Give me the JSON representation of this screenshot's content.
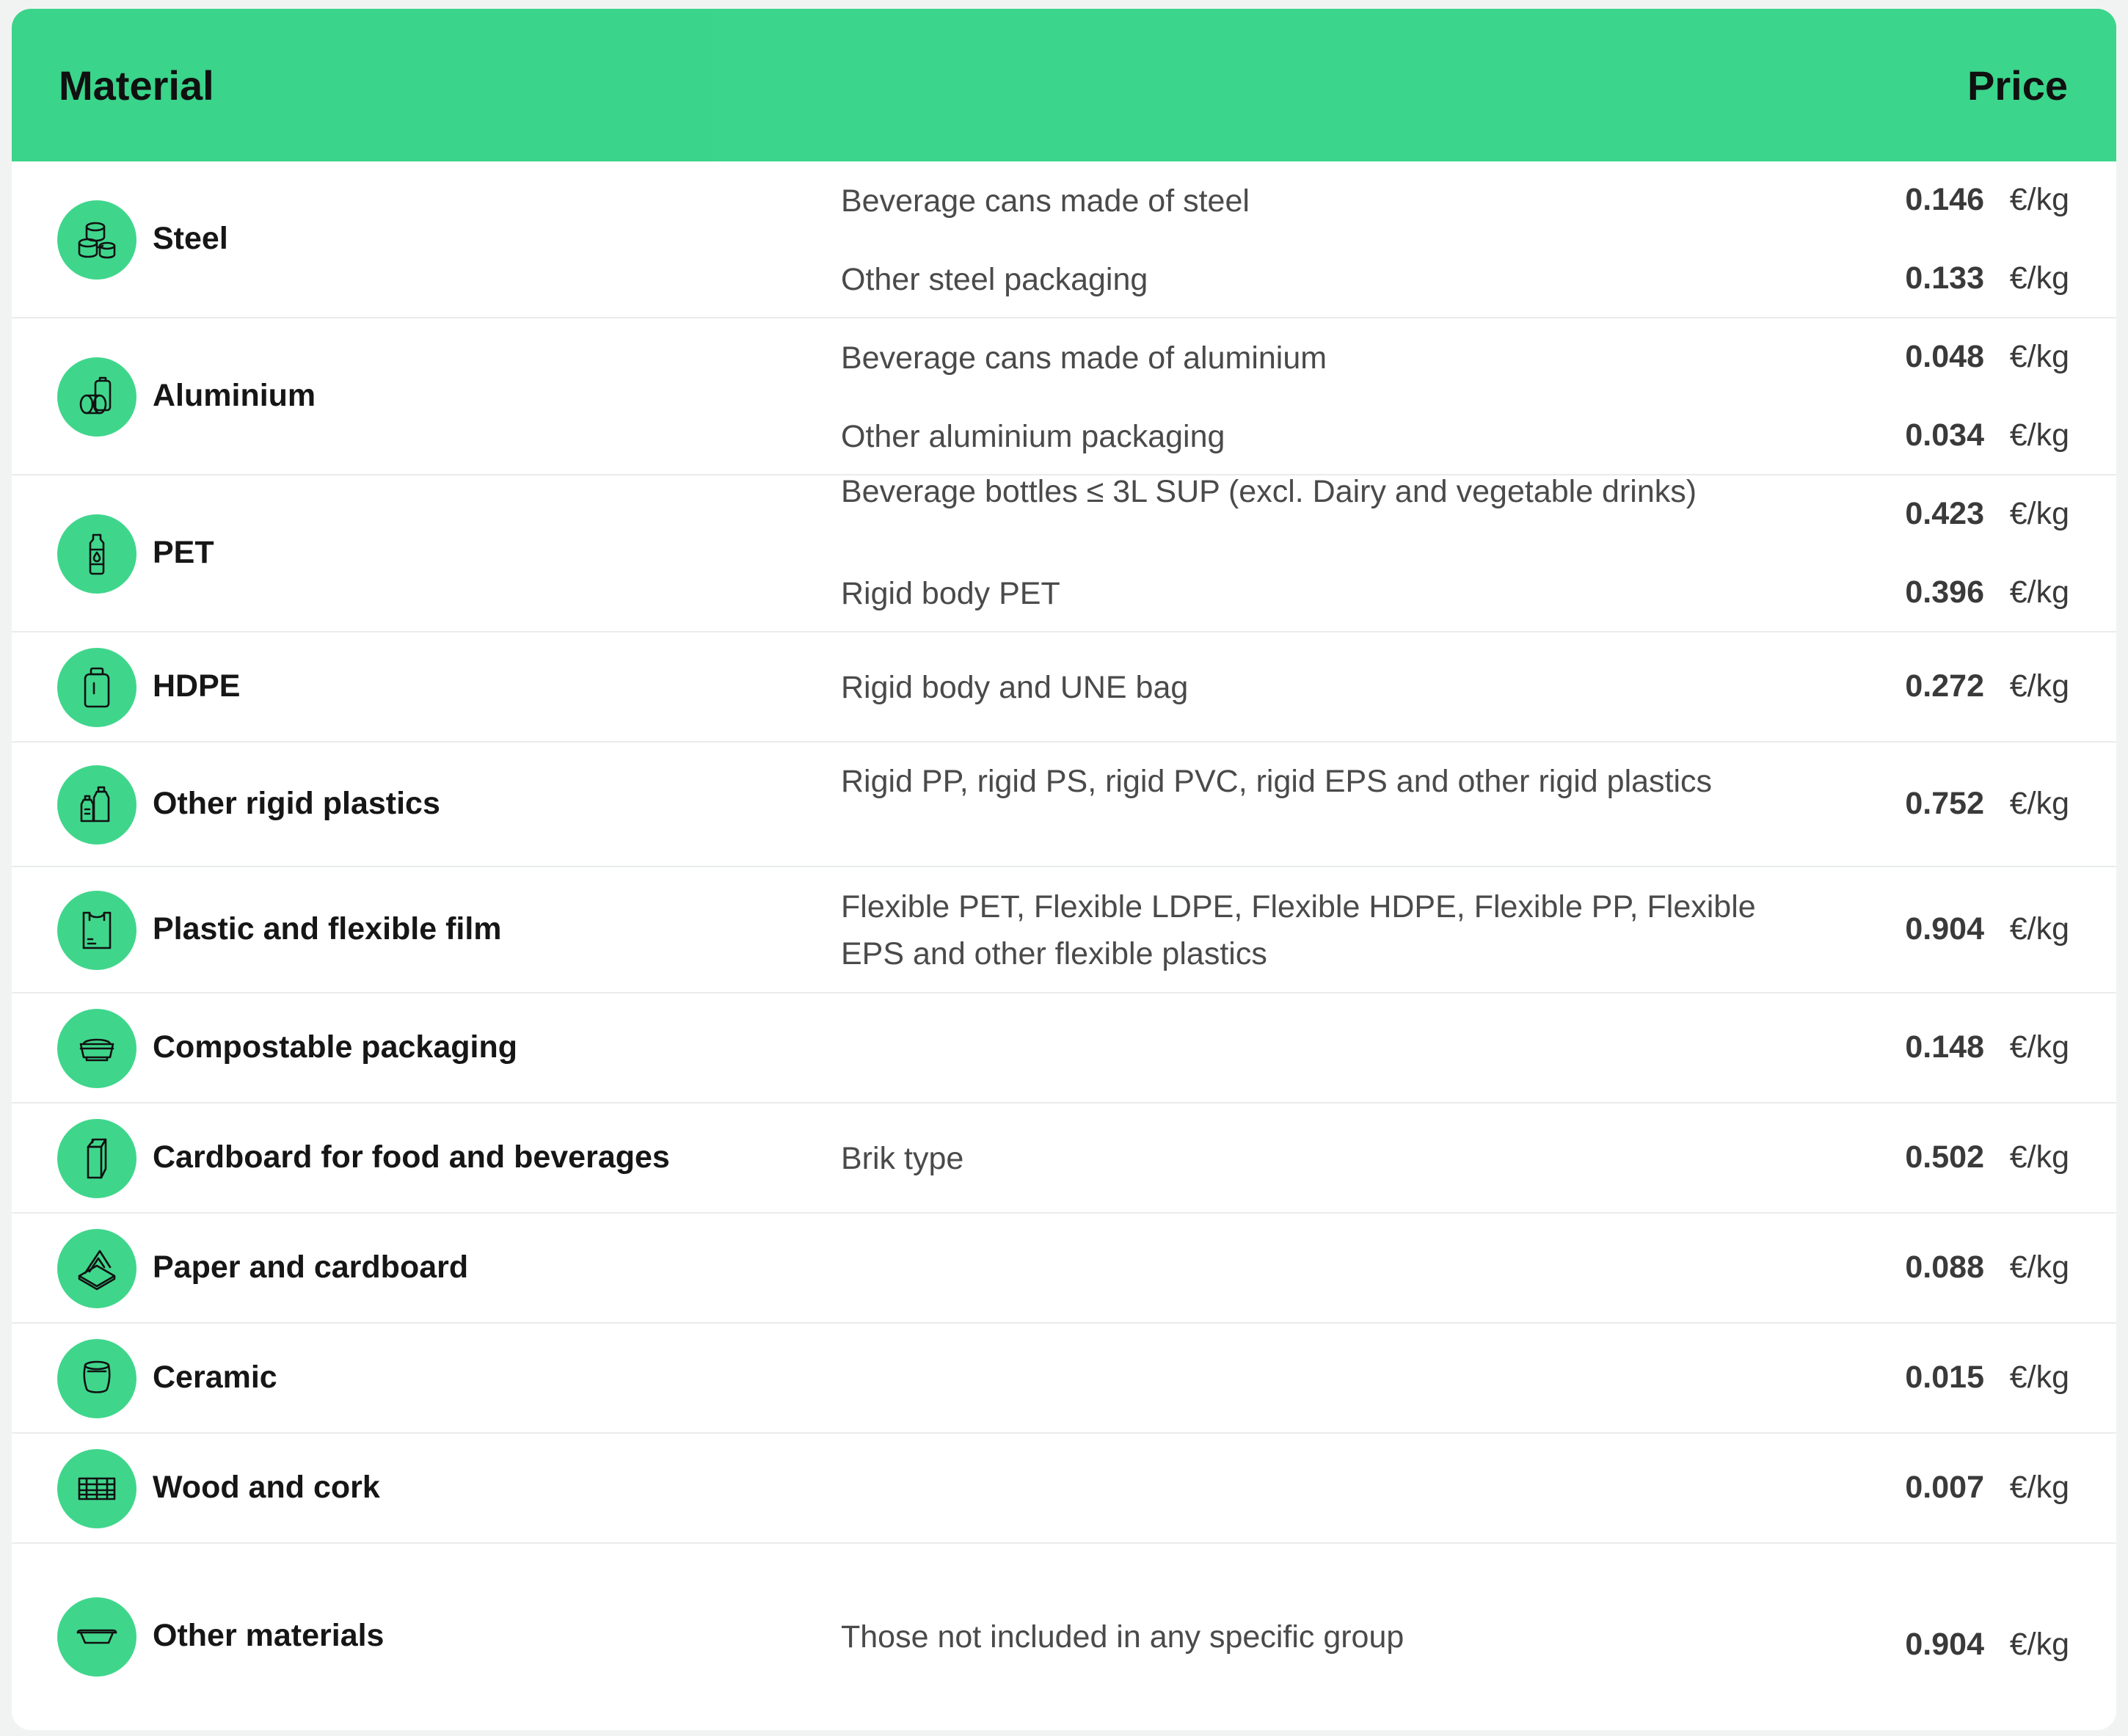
{
  "header": {
    "material_label": "Material",
    "price_label": "Price"
  },
  "rows": [
    {
      "icon": "steel-cans-icon",
      "name": "Steel",
      "items": [
        {
          "description": "Beverage cans made of steel",
          "price": "0.146",
          "unit": "€/kg"
        },
        {
          "description": "Other steel packaging",
          "price": "0.133",
          "unit": "€/kg"
        }
      ]
    },
    {
      "icon": "aluminium-cans-icon",
      "name": "Aluminium",
      "items": [
        {
          "description": "Beverage cans made of aluminium",
          "price": "0.048",
          "unit": "€/kg"
        },
        {
          "description": "Other aluminium packaging",
          "price": "0.034",
          "unit": "€/kg"
        }
      ]
    },
    {
      "icon": "bottle-icon",
      "name": "PET",
      "items": [
        {
          "description": "Beverage bottles ≤ 3L SUP (excl. Dairy and vegetable drinks)",
          "price": "0.423",
          "unit": "€/kg"
        },
        {
          "description": "Rigid body PET",
          "price": "0.396",
          "unit": "€/kg"
        }
      ]
    },
    {
      "icon": "jar-icon",
      "name": "HDPE",
      "items": [
        {
          "description": "Rigid body and UNE bag",
          "price": "0.272",
          "unit": "€/kg"
        }
      ]
    },
    {
      "icon": "plastic-containers-icon",
      "name": "Other rigid plastics",
      "items": [
        {
          "description": "Rigid PP, rigid PS, rigid PVC, rigid EPS and other rigid plastics",
          "price": "0.752",
          "unit": "€/kg"
        }
      ]
    },
    {
      "icon": "plastic-bag-icon",
      "name": "Plastic and flexible film",
      "items": [
        {
          "description": "Flexible PET, Flexible LDPE, Flexible HDPE, Flexible PP, Flexible EPS and other flexible plastics",
          "price": "0.904",
          "unit": "€/kg"
        }
      ]
    },
    {
      "icon": "food-container-icon",
      "name": "Compostable packaging",
      "items": [
        {
          "description": "",
          "price": "0.148",
          "unit": "€/kg"
        }
      ]
    },
    {
      "icon": "milk-carton-icon",
      "name": "Cardboard for food and beverages",
      "items": [
        {
          "description": "Brik type",
          "price": "0.502",
          "unit": "€/kg"
        }
      ]
    },
    {
      "icon": "pizza-box-icon",
      "name": "Paper and cardboard",
      "items": [
        {
          "description": "",
          "price": "0.088",
          "unit": "€/kg"
        }
      ]
    },
    {
      "icon": "ceramic-pot-icon",
      "name": "Ceramic",
      "items": [
        {
          "description": "",
          "price": "0.015",
          "unit": "€/kg"
        }
      ]
    },
    {
      "icon": "wood-pallet-icon",
      "name": "Wood and cork",
      "items": [
        {
          "description": "",
          "price": "0.007",
          "unit": "€/kg"
        }
      ]
    },
    {
      "icon": "tray-icon",
      "name": "Other materials",
      "items": [
        {
          "description": "Those not included in any specific group",
          "price": "0.904",
          "unit": "€/kg"
        }
      ]
    }
  ],
  "colors": {
    "header_bg": "#3ad48a",
    "icon_bg": "#3fd68c",
    "divider": "#e9ecea"
  }
}
